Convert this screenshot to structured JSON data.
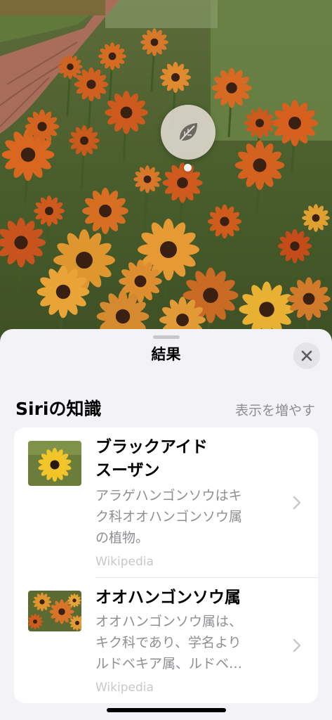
{
  "photo": {
    "subject": "black-eyed susan flower field",
    "lookup_icon": "leaf-icon"
  },
  "sheet": {
    "title": "結果",
    "close_icon": "close-icon"
  },
  "section": {
    "header": "Siriの知識",
    "show_more": "表示を増やす"
  },
  "results": [
    {
      "title_line1": "ブラックアイド",
      "title_line2": "スーザン",
      "desc_line1": "アラゲハンゴンソウはキ",
      "desc_line2": "ク科オオハンゴンソウ属",
      "desc_line3": "の植物。",
      "source": "Wikipedia",
      "thumbnail": "single yellow black-eyed susan flower"
    },
    {
      "title_line1": "オオハンゴンソウ属",
      "desc_line1": "オオハンゴンソウ属は、",
      "desc_line2": "キク科であり、学名より",
      "desc_line3": "ルドベキア属、ルドベ…",
      "source": "Wikipedia",
      "thumbnail": "orange rudbeckia flowers"
    }
  ],
  "colors": {
    "sheet_background": "#f2f2f7",
    "card_background": "#ffffff",
    "secondary_text": "#8e8e93",
    "tertiary_text": "#c7c7cc"
  }
}
